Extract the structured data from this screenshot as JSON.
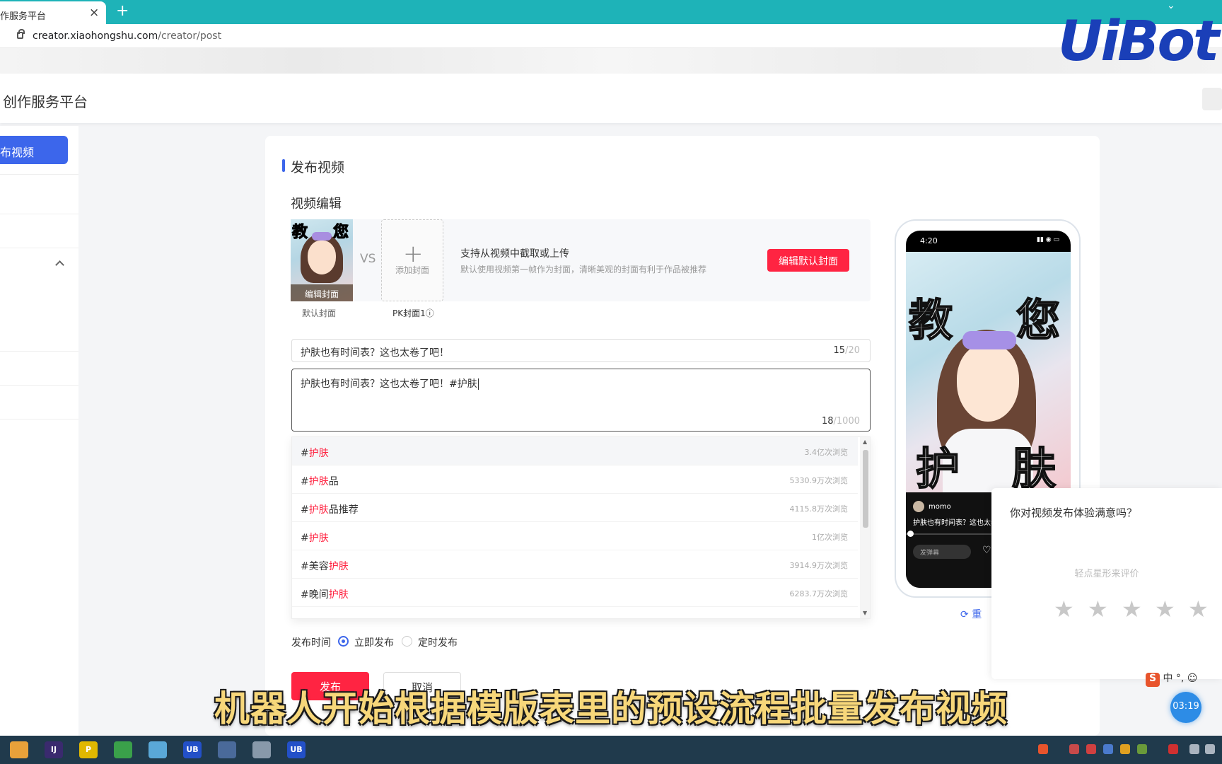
{
  "browser": {
    "tab_title": "作服务平台",
    "tab_close": "×",
    "new_tab": "+",
    "url_host": "creator.xiaohongshu.com",
    "url_path": "/creator/post"
  },
  "watermark": {
    "logo": "UiBot"
  },
  "header": {
    "title": "创作服务平台"
  },
  "sidebar": {
    "active_item": "布视频"
  },
  "card": {
    "title": "发布视频",
    "section_title": "视频编辑",
    "cover": {
      "thumb_text_left": "教",
      "thumb_text_right": "您",
      "edit_label": "编辑封面",
      "vs": "VS",
      "add_plus": "+",
      "add_label": "添加封面",
      "default_caption": "默认封面",
      "pk_caption": "PK封面1ⓘ",
      "info_title": "支持从视频中截取或上传",
      "info_sub": "默认使用视频第一帧作为封面，清晰美观的封面有利于作品被推荐",
      "edit_default_button": "编辑默认封面"
    },
    "title_input": {
      "value": "护肤也有时间表？这也太卷了吧！",
      "count": "15",
      "max": "/20"
    },
    "desc_input": {
      "value": "护肤也有时间表？这也太卷了吧！#护肤",
      "count": "18",
      "max": "/1000"
    },
    "suggestions": [
      {
        "prefix": "#",
        "hl": "护肤",
        "suffix": "",
        "views": "3.4亿次浏览"
      },
      {
        "prefix": "#",
        "hl": "护肤",
        "suffix": "品",
        "views": "5330.9万次浏览"
      },
      {
        "prefix": "#",
        "hl": "护肤",
        "suffix": "品推荐",
        "views": "4115.8万次浏览"
      },
      {
        "prefix": "#",
        "hl": "护肤",
        "suffix": "",
        "views": "1亿次浏览"
      },
      {
        "prefix": "#美容",
        "hl": "护肤",
        "suffix": "",
        "views": "3914.9万次浏览"
      },
      {
        "prefix": "#晚间",
        "hl": "护肤",
        "suffix": "",
        "views": "6283.7万次浏览"
      }
    ],
    "publish_time": {
      "label": "发布时间",
      "option_now": "立即发布",
      "option_scheduled": "定时发布",
      "selected": "立即发布"
    },
    "publish_button": "发布",
    "cancel_button": "取消"
  },
  "preview": {
    "time": "4:20",
    "signal": "▮▮ ◉ ▭",
    "big_text": [
      "教",
      "您",
      "护",
      "肤"
    ],
    "username": "momo",
    "caption": "护肤也有时间表？这也太卷",
    "danmaku": "发弹幕",
    "heart": "♡",
    "refresh": "重"
  },
  "survey": {
    "question": "你对视频发布体验满意吗？",
    "hint": "轻点星形来评价",
    "stars": [
      "★",
      "★",
      "★",
      "★",
      "★"
    ]
  },
  "ime": {
    "logo": "S",
    "text": "中 °, ☺"
  },
  "timer": "03:19",
  "subtitle": "机器人开始根据模版表里的预设流程批量发布视频",
  "taskbar": {
    "icons": [
      {
        "label": "",
        "color": "#e8a13a"
      },
      {
        "label": "IJ",
        "color": "#3a2a6e"
      },
      {
        "label": "P",
        "color": "#e0b800"
      },
      {
        "label": "",
        "color": "#3aa04a"
      },
      {
        "label": "",
        "color": "#5aa8d8"
      },
      {
        "label": "UB",
        "color": "#2350c8"
      },
      {
        "label": "",
        "color": "#4a6a9a"
      },
      {
        "label": "",
        "color": "#8899aa"
      },
      {
        "label": "UB",
        "color": "#2350c8"
      }
    ]
  }
}
